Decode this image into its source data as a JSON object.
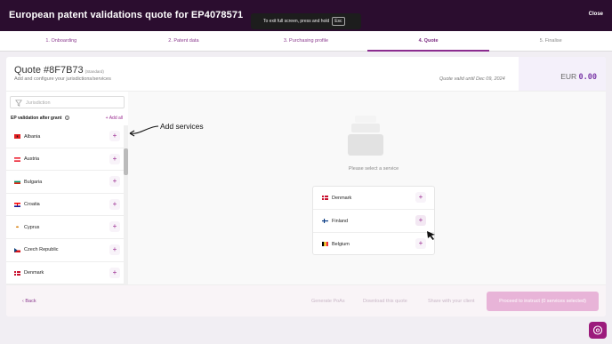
{
  "header": {
    "title": "European patent validations quote for EP4078571",
    "close_label": "Close",
    "fullscreen_toast": "To exit full screen, press and hold",
    "fullscreen_key": "Esc"
  },
  "steps": [
    {
      "label": "1. Onboarding",
      "state": "done"
    },
    {
      "label": "2. Patent data",
      "state": "done"
    },
    {
      "label": "3. Purchasing profile",
      "state": "done"
    },
    {
      "label": "4. Quote",
      "state": "active"
    },
    {
      "label": "5. Finalise",
      "state": "future"
    }
  ],
  "quote": {
    "title": "Quote #8F7B73",
    "type": "(Standard)",
    "subtitle": "Add and configure your jurisdictions/services",
    "valid_until": "Quote valid until Dec 09, 2024",
    "currency": "EUR",
    "amount": "0.00"
  },
  "sidebar": {
    "search_placeholder": "Jurisdiction",
    "group_title": "EP validation after grant",
    "add_all_label": "+ Add all",
    "jurisdictions": [
      {
        "name": "Albania",
        "flag": "albania-flag"
      },
      {
        "name": "Austria",
        "flag": "austria-flag"
      },
      {
        "name": "Bulgaria",
        "flag": "bulgaria-flag"
      },
      {
        "name": "Croatia",
        "flag": "croatia-flag"
      },
      {
        "name": "Cyprus",
        "flag": "cyprus-flag"
      },
      {
        "name": "Czech Republic",
        "flag": "czech-republic-flag"
      },
      {
        "name": "Denmark",
        "flag": "denmark-flag"
      }
    ]
  },
  "content": {
    "annotation": "Add services",
    "empty_text": "Please select a service",
    "selected": [
      {
        "name": "Denmark",
        "flag": "denmark-flag"
      },
      {
        "name": "Finland",
        "flag": "finland-flag"
      },
      {
        "name": "Belgium",
        "flag": "belgium-flag"
      }
    ]
  },
  "footer": {
    "back_label": "‹ Back",
    "generate_label": "Generate PoAs",
    "download_label": "Download this quote",
    "share_label": "Share with your client",
    "proceed_label": "Proceed to instruct (0 services selected)"
  },
  "colors": {
    "header_bg": "#2b0d2f",
    "accent": "#8b2c8f",
    "primary_disabled": "#e8b4d8",
    "help_bg": "#9c1b7c"
  }
}
